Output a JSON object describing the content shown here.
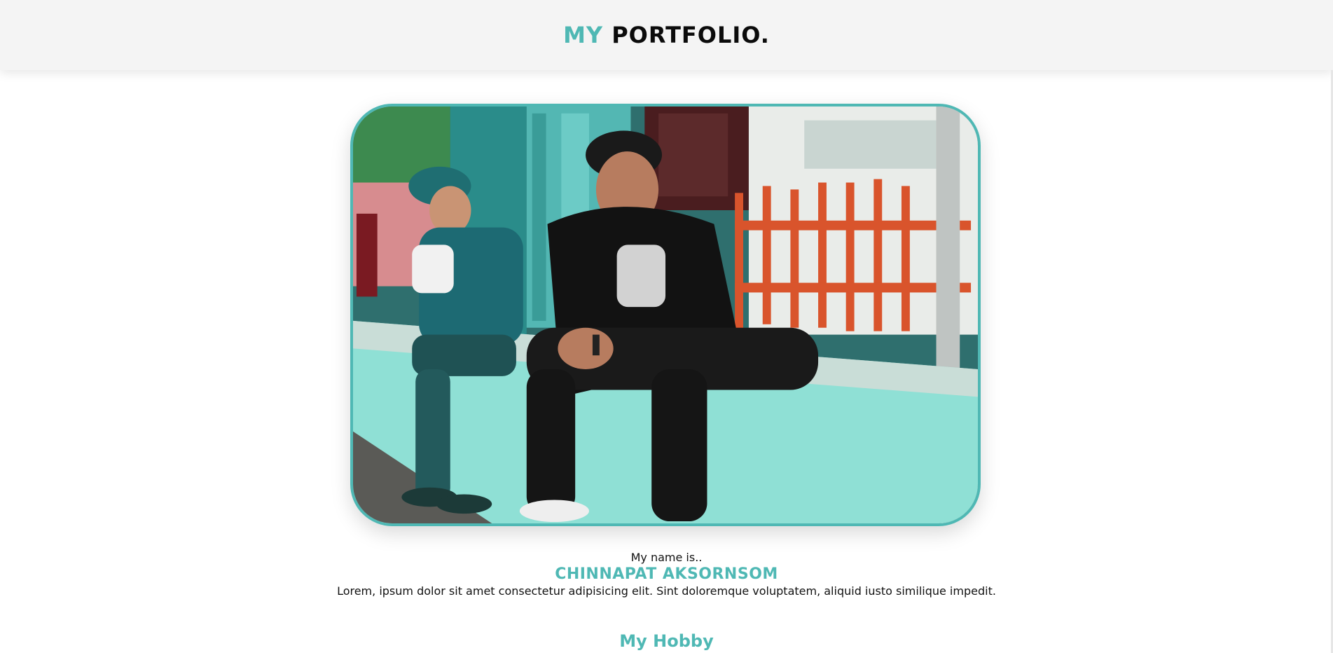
{
  "header": {
    "brand_accent": "MY",
    "brand_rest": "PORTFOLIO."
  },
  "hero": {
    "image_alt": "Two young men sitting on a turquoise ledge in front of a shop"
  },
  "intro": {
    "label": "My name is..",
    "name": "CHINNAPAT AKSORNSOM",
    "description": "Lorem, ipsum dolor sit amet consectetur adipisicing elit. Sint doloremque voluptatem, aliquid iusto similique impedit."
  },
  "hobby": {
    "title": "My Hobby"
  },
  "colors": {
    "accent": "#4fb8b4",
    "header_bg": "#f4f4f4",
    "text": "#111111"
  }
}
